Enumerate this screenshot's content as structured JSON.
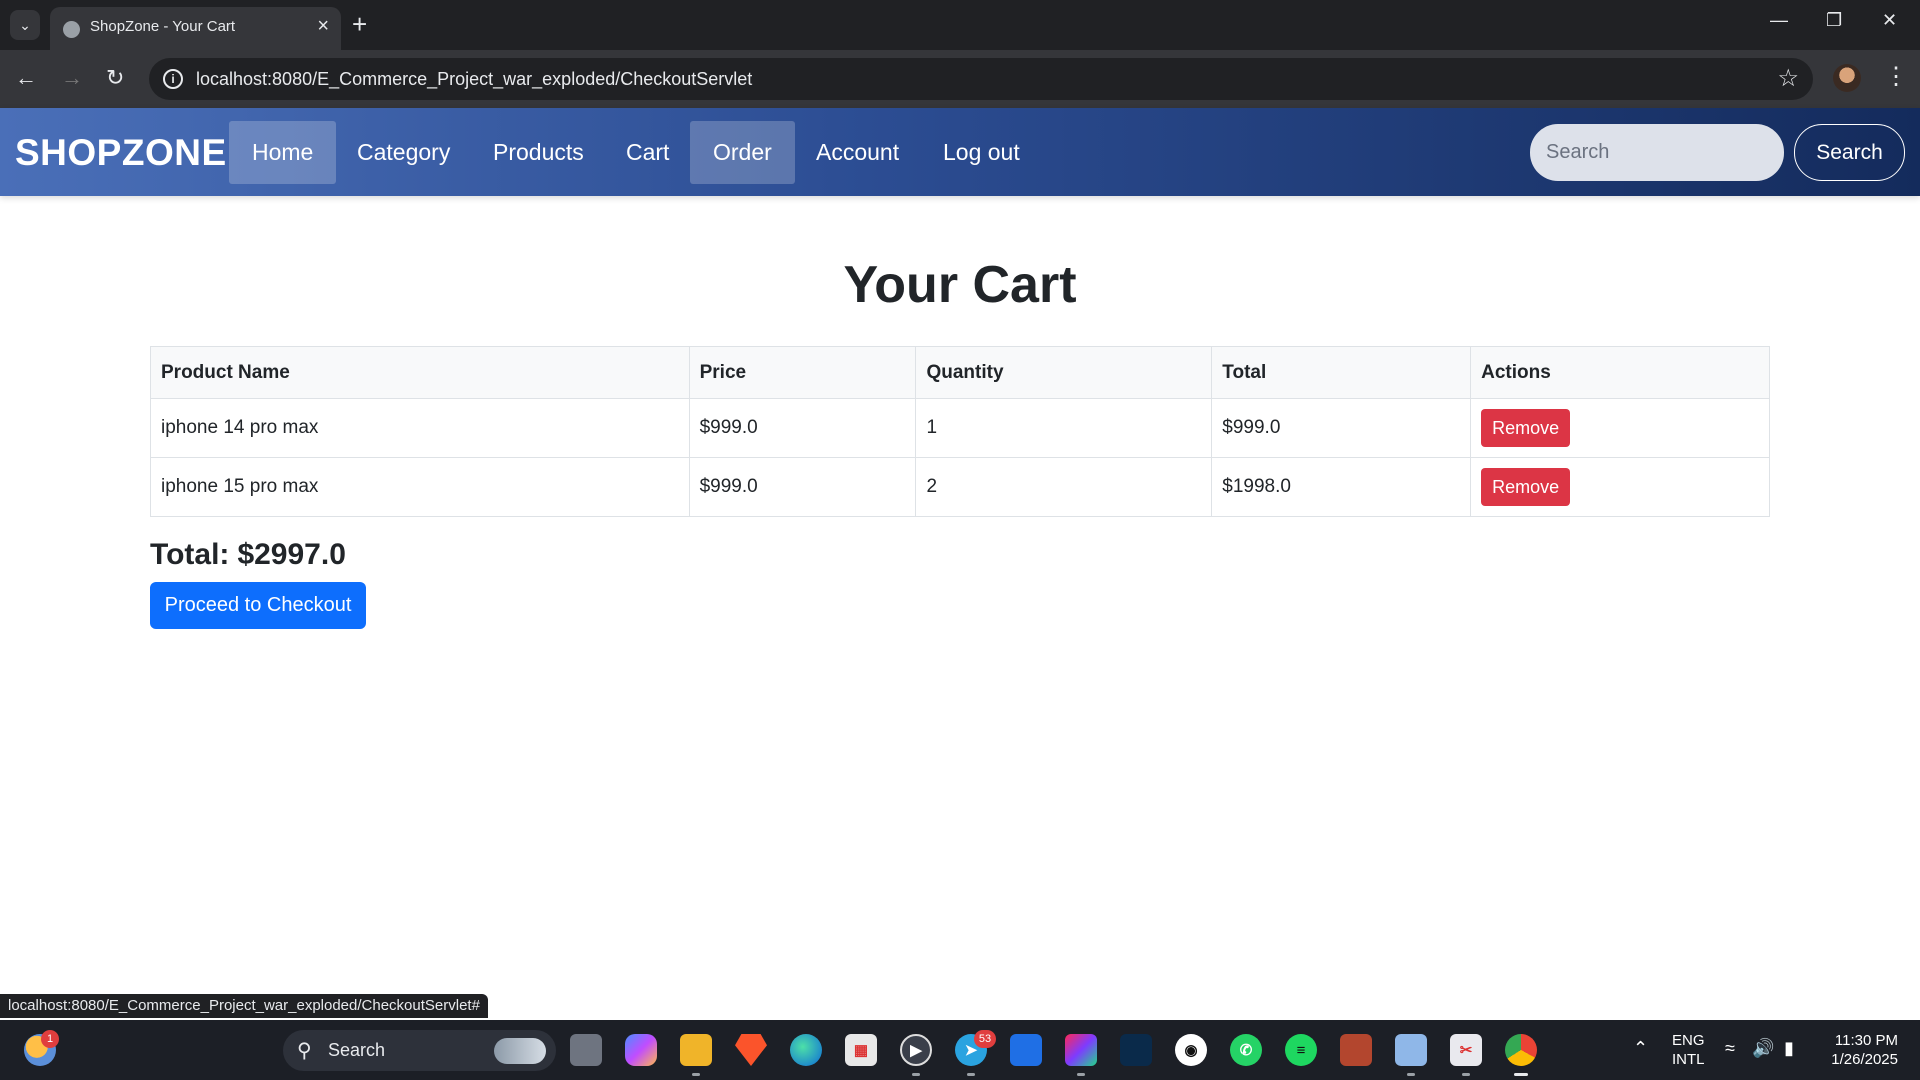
{
  "browser": {
    "tab_title": "ShopZone - Your Cart",
    "url": "localhost:8080/E_Commerce_Project_war_exploded/CheckoutServlet",
    "status_url": "localhost:8080/E_Commerce_Project_war_exploded/CheckoutServlet#",
    "icons": [
      "tab-list-icon",
      "globe-icon",
      "close-icon",
      "plus-icon",
      "minimize-icon",
      "restore-icon",
      "back-icon",
      "forward-icon",
      "reload-icon",
      "info-icon",
      "star-icon",
      "kebab-menu-icon"
    ]
  },
  "navbar": {
    "brand": "SHOPZONE",
    "links": [
      "Home",
      "Category",
      "Products",
      "Cart",
      "Order",
      "Account",
      "Log out"
    ],
    "active_links": [
      "Home",
      "Order"
    ],
    "search_placeholder": "Search",
    "search_button": "Search",
    "gradient_colors": [
      "#4a6fb8",
      "#2c4d93",
      "#142b5c"
    ]
  },
  "main": {
    "heading": "Your Cart",
    "table": {
      "headers": [
        "Product Name",
        "Price",
        "Quantity",
        "Total",
        "Actions"
      ],
      "rows": [
        {
          "product": "iphone 14 pro max",
          "price": "$999.0",
          "quantity": "1",
          "total": "$999.0",
          "action": "Remove"
        },
        {
          "product": "iphone 15 pro max",
          "price": "$999.0",
          "quantity": "2",
          "total": "$1998.0",
          "action": "Remove"
        }
      ]
    },
    "total_label": "Total:",
    "total_value": "$2997.0",
    "checkout_button": "Proceed to Checkout",
    "colors": {
      "remove": "#dc3545",
      "checkout": "#0d6efd"
    }
  },
  "taskbar": {
    "weather_badge": "1",
    "search_label": "Search",
    "telegram_badge": "53",
    "apps": [
      "file-explorer-icon",
      "copilot-icon",
      "folder-icon",
      "brave-icon",
      "edge-icon",
      "store-icon",
      "media-player-icon",
      "telegram-icon",
      "vpn-icon",
      "intellij-icon",
      "mysql-icon",
      "github-icon",
      "whatsapp-icon",
      "spotify-icon",
      "game-icon",
      "photos-icon",
      "snipping-icon",
      "chrome-icon"
    ],
    "lang_line1": "ENG",
    "lang_line2": "INTL",
    "time": "11:30 PM",
    "date": "1/26/2025"
  }
}
